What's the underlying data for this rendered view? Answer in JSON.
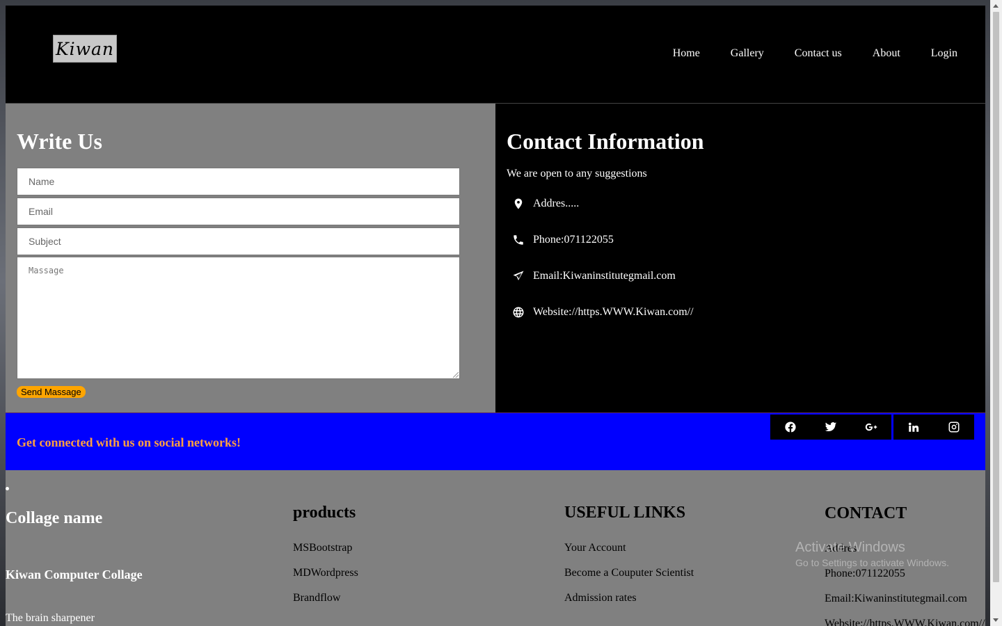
{
  "header": {
    "logo": "Kiwan",
    "nav": [
      "Home",
      "Gallery",
      "Contact us",
      "About",
      "Login"
    ]
  },
  "write_us": {
    "title": "Write Us",
    "name_placeholder": "Name",
    "email_placeholder": "Email",
    "subject_placeholder": "Subject",
    "message_placeholder": "Massage",
    "send_label": "Send Massage"
  },
  "contact_info": {
    "title": "Contact Information",
    "lead": "We are open to any suggestions",
    "address": "Addres.....",
    "phone": "Phone:071122055",
    "email": "Email:Kiwaninstitutegmail.com",
    "website": "Website://https.WWW.Kiwan.com//",
    "icons": [
      "map-pin-icon",
      "phone-icon",
      "send-icon",
      "globe-icon"
    ]
  },
  "social": {
    "tagline": "Get connected with us on social networks!",
    "icons": [
      "facebook-icon",
      "twitter-icon",
      "google-plus-icon",
      "linkedin-icon",
      "instagram-icon"
    ],
    "colors": {
      "bar": "#0000ff",
      "tagline": "#ffa040"
    }
  },
  "footer": {
    "college": {
      "title": "Collage name",
      "name": "Kiwan Computer Collage",
      "tagline": "The brain sharpener"
    },
    "products": {
      "title": "products",
      "items": [
        "MSBootstrap",
        "MDWordpress",
        "Brandflow"
      ]
    },
    "links": {
      "title": "USEFUL LINKS",
      "items": [
        "Your Account",
        "Become a Couputer Scientist",
        "Admission rates"
      ]
    },
    "contact": {
      "title": "CONTACT",
      "items": [
        "Addres",
        "Phone:071122055",
        "Email:Kiwaninstitutegmail.com",
        "Website://https.WWW.Kiwan.com//"
      ]
    }
  },
  "watermark": {
    "line1": "Activate Windows",
    "line2": "Go to Settings to activate Windows."
  }
}
